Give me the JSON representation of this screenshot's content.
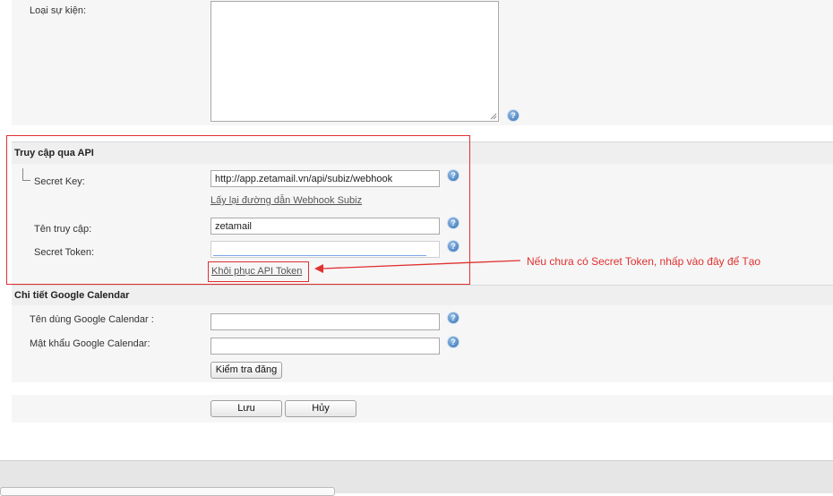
{
  "event_type": {
    "label": "Loại sự kiện:"
  },
  "api_section": {
    "title": "Truy cập qua API",
    "secret_key": {
      "label": "Secret Key:",
      "value": "http://app.zetamail.vn/api/subiz/webhook"
    },
    "webhook_link": "Lấy lại đường dẫn Webhook Subiz",
    "username": {
      "label": "Tên truy cập:",
      "value": "zetamail"
    },
    "secret_token": {
      "label": "Secret Token:",
      "value": ""
    },
    "restore_token_link": "Khôi phục API Token"
  },
  "annotation": {
    "text": "Nếu chưa có Secret Token, nhấp vào đây để Tạo",
    "color": "#e03030"
  },
  "google_section": {
    "title": "Chi tiết Google Calendar",
    "username": {
      "label": "Tên dùng Google Calendar :",
      "value": ""
    },
    "password": {
      "label": "Mật khẩu Google Calendar:",
      "value": ""
    },
    "check_button": "Kiểm tra đăng"
  },
  "actions": {
    "save": "Lưu",
    "cancel": "Hủy"
  },
  "help_icon": "?",
  "colors": {
    "accent_red": "#e03030",
    "help_blue": "#4d86c3"
  }
}
